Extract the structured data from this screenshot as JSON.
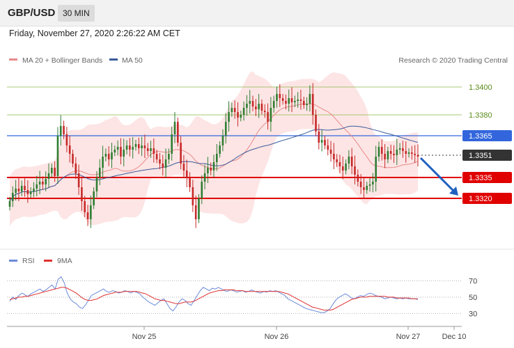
{
  "header": {
    "symbol": "GBP/USD",
    "timeframe": "30 MIN",
    "datetime": "Friday, November 27, 2020 2:26:22 AM CET"
  },
  "legend": {
    "ma20": "MA 20 + Bollinger Bands",
    "ma50": "MA 50",
    "copyright": "Research © 2020 Trading Central"
  },
  "rsi_legend": {
    "rsi": "RSI",
    "ma9": "9MA"
  },
  "colors": {
    "ma20": "#e88a8a",
    "ma50": "#3a5a99",
    "band": "#fde0e0",
    "bull": "#2e7d32",
    "bear": "#c62828",
    "support": "#e00000",
    "resistance": "#3366dd",
    "target": "#2060c0",
    "last": "#333333",
    "green_level": "#8ab84a",
    "rsi": "#6a8ad8",
    "rsi_ma": "#e03030"
  },
  "chart_data": [
    {
      "type": "candlestick",
      "title": "GBP/USD",
      "timeframe": "30 MIN",
      "ylim": [
        1.329,
        1.3415
      ],
      "x_ticks": [
        "Nov 25",
        "Nov 26",
        "Nov 27",
        "Dec 10"
      ],
      "levels": [
        {
          "label": "1.3400",
          "value": 1.34,
          "kind": "green"
        },
        {
          "label": "1.3380",
          "value": 1.338,
          "kind": "green"
        },
        {
          "label": "1.3365",
          "value": 1.3365,
          "kind": "resistance"
        },
        {
          "label": "1.3351",
          "value": 1.3351,
          "kind": "last"
        },
        {
          "label": "1.3335",
          "value": 1.3335,
          "kind": "support"
        },
        {
          "label": "1.3320",
          "value": 1.332,
          "kind": "support"
        }
      ],
      "series": [
        {
          "name": "MA 20 + Bollinger Bands"
        },
        {
          "name": "MA 50"
        }
      ],
      "prices": [
        1.3318,
        1.3324,
        1.3327,
        1.3325,
        1.3329,
        1.3326,
        1.3323,
        1.3325,
        1.3327,
        1.333,
        1.3332,
        1.333,
        1.3334,
        1.3338,
        1.3342,
        1.3336,
        1.3365,
        1.3372,
        1.3366,
        1.3358,
        1.3352,
        1.3345,
        1.3338,
        1.3328,
        1.3318,
        1.331,
        1.3305,
        1.3315,
        1.3325,
        1.3335,
        1.3342,
        1.335,
        1.3352,
        1.3348,
        1.3353,
        1.3355,
        1.3357,
        1.335,
        1.3355,
        1.3358,
        1.3355,
        1.3357,
        1.3359,
        1.3356,
        1.3358,
        1.3356,
        1.3354,
        1.3356,
        1.3352,
        1.3348,
        1.3345,
        1.3342,
        1.3348,
        1.3352,
        1.3366,
        1.3375,
        1.336,
        1.3345,
        1.334,
        1.3335,
        1.3328,
        1.3315,
        1.3305,
        1.332,
        1.3332,
        1.3338,
        1.3342,
        1.334,
        1.3346,
        1.3352,
        1.3358,
        1.3365,
        1.3375,
        1.3382,
        1.3385,
        1.3382,
        1.3378,
        1.338,
        1.3385,
        1.3388,
        1.339,
        1.3386,
        1.3384,
        1.3388,
        1.3383,
        1.3382,
        1.3375,
        1.3385,
        1.339,
        1.3395,
        1.3392,
        1.339,
        1.3388,
        1.3392,
        1.3389,
        1.339,
        1.3391,
        1.339,
        1.3387,
        1.3388,
        1.3395,
        1.338,
        1.3368,
        1.336,
        1.3362,
        1.3358,
        1.3355,
        1.3352,
        1.3348,
        1.3346,
        1.3343,
        1.334,
        1.3345,
        1.335,
        1.3343,
        1.3337,
        1.3332,
        1.3328,
        1.3326,
        1.3329,
        1.333,
        1.3332,
        1.335,
        1.3357,
        1.3352,
        1.3348,
        1.3354,
        1.3352,
        1.3351,
        1.3355,
        1.3356,
        1.3354,
        1.3352,
        1.3353,
        1.3352,
        1.3351,
        1.335
      ]
    },
    {
      "type": "line",
      "title": "RSI",
      "ylim": [
        20,
        85
      ],
      "y_ticks": [
        70,
        50,
        30
      ],
      "series": [
        {
          "name": "RSI",
          "values": [
            45,
            50,
            47,
            52,
            55,
            53,
            51,
            54,
            56,
            58,
            60,
            57,
            59,
            62,
            65,
            60,
            72,
            75,
            68,
            55,
            48,
            44,
            42,
            38,
            36,
            40,
            46,
            52,
            54,
            56,
            58,
            60,
            57,
            56,
            58,
            57,
            55,
            56,
            58,
            57,
            55,
            57,
            56,
            54,
            50,
            47,
            44,
            42,
            40,
            43,
            46,
            48,
            42,
            36,
            33,
            38,
            44,
            48,
            46,
            42,
            40,
            46,
            52,
            58,
            62,
            60,
            58,
            61,
            60,
            62,
            60,
            58,
            57,
            59,
            58,
            56,
            57,
            58,
            56,
            57,
            59,
            57,
            56,
            55,
            57,
            56,
            58,
            57,
            58,
            56,
            54,
            52,
            48,
            46,
            44,
            42,
            40,
            38,
            36,
            35,
            34,
            33,
            32,
            31,
            31,
            33,
            36,
            42,
            47,
            50,
            52,
            54,
            52,
            49,
            48,
            50,
            52,
            51,
            53,
            55,
            54,
            52,
            51,
            50,
            48,
            49,
            50,
            49,
            48,
            49,
            48,
            49,
            48,
            48,
            48,
            47
          ]
        },
        {
          "name": "9MA",
          "values": [
            47,
            48,
            49,
            50,
            50,
            51,
            51,
            52,
            53,
            54,
            55,
            56,
            57,
            58,
            59,
            60,
            61,
            62,
            62,
            61,
            59,
            57,
            55,
            52,
            49,
            47,
            46,
            46,
            47,
            48,
            50,
            52,
            53,
            54,
            55,
            56,
            56,
            56,
            57,
            57,
            57,
            57,
            57,
            56,
            55,
            54,
            52,
            50,
            48,
            47,
            46,
            46,
            45,
            44,
            43,
            42,
            42,
            43,
            44,
            44,
            44,
            45,
            47,
            49,
            51,
            53,
            55,
            56,
            57,
            58,
            58,
            59,
            59,
            59,
            59,
            58,
            58,
            58,
            57,
            57,
            57,
            57,
            57,
            57,
            57,
            57,
            57,
            57,
            57,
            57,
            56,
            55,
            54,
            52,
            50,
            48,
            46,
            44,
            42,
            40,
            38,
            37,
            36,
            35,
            34,
            34,
            34,
            35,
            37,
            39,
            41,
            43,
            45,
            47,
            48,
            49,
            50,
            50,
            50,
            51,
            51,
            51,
            51,
            51,
            51,
            50,
            50,
            50,
            49,
            49,
            49,
            49,
            49,
            48,
            48,
            48
          ]
        }
      ]
    }
  ]
}
